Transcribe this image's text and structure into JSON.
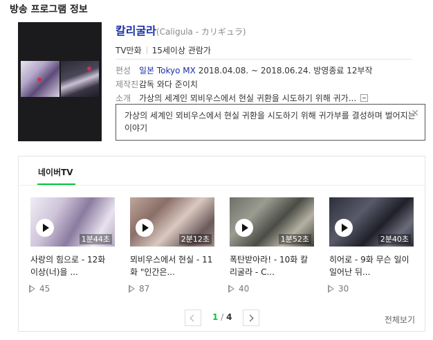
{
  "section_title": "방송 프로그램 정보",
  "program": {
    "title": "칼리굴라",
    "subtitle": "(Caligula - カリギュラ)",
    "genre": "TV만화",
    "rating": "15세이상 관람가",
    "schedule": {
      "label": "편성",
      "channel": "일본 Tokyo MX",
      "period": "2018.04.08. ~ 2018.06.24. 방영종료 12부작"
    },
    "staff": {
      "label": "제작진",
      "value": "감독 와다 준이치"
    },
    "synopsis": {
      "label": "소개",
      "short": "가상의 세계인 뫼비우스에서 현실 귀환을 시도하기 위해 귀가..."
    }
  },
  "popup": {
    "text": "가상의 세계인 뫼비우스에서 현실 귀환을 시도하기 위해 귀가부를 결성하며 벌어지는 이야기",
    "close_icon": "close-icon"
  },
  "panel": {
    "tab_label": "네이버TV",
    "accent_color": "#00c73c",
    "clips": [
      {
        "duration": "1분44초",
        "title": "사랑의 힘으로 - 12화 이상(너)을 ...",
        "views": "45"
      },
      {
        "duration": "2분12초",
        "title": "뫼비우스에서 현실 - 11화 \"인간은...",
        "views": "87"
      },
      {
        "duration": "1분52초",
        "title": "폭탄받아라! - 10화 칼리굴라 - C...",
        "views": "40"
      },
      {
        "duration": "2분40초",
        "title": "히어로 - 9화 무슨 일이 일어난 뒤...",
        "views": "30"
      }
    ],
    "pager": {
      "current": "1",
      "separator": "/",
      "total": "4"
    },
    "view_all": "전체보기"
  }
}
